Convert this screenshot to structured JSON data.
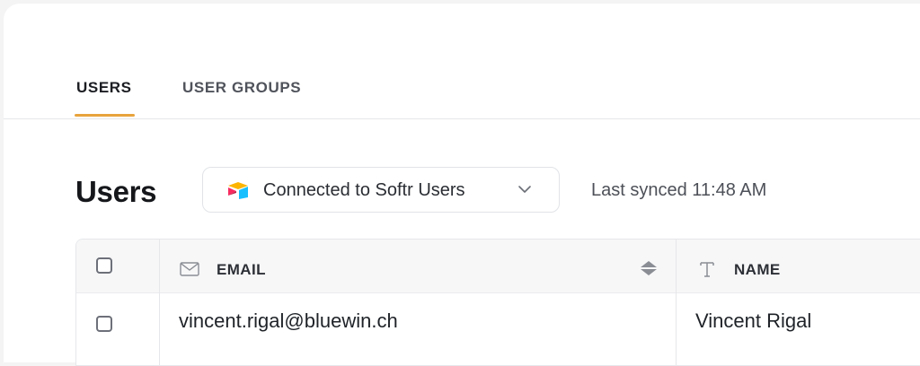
{
  "tabs": [
    {
      "label": "USERS",
      "active": true
    },
    {
      "label": "USER GROUPS",
      "active": false
    }
  ],
  "header": {
    "title": "Users",
    "data_source": {
      "label": "Connected to Softr Users",
      "icon": "airtable-logo-icon"
    },
    "sync_status": "Last synced 11:48 AM"
  },
  "table": {
    "columns": [
      {
        "label": "EMAIL",
        "icon": "mail-icon",
        "sortable": true
      },
      {
        "label": "NAME",
        "icon": "text-type-icon",
        "sortable": false
      }
    ],
    "rows": [
      {
        "email": "vincent.rigal@bluewin.ch",
        "name": "Vincent Rigal"
      }
    ]
  },
  "colors": {
    "accent": "#e8a33d",
    "background": "#f4f4f5",
    "panel": "#ffffff"
  }
}
